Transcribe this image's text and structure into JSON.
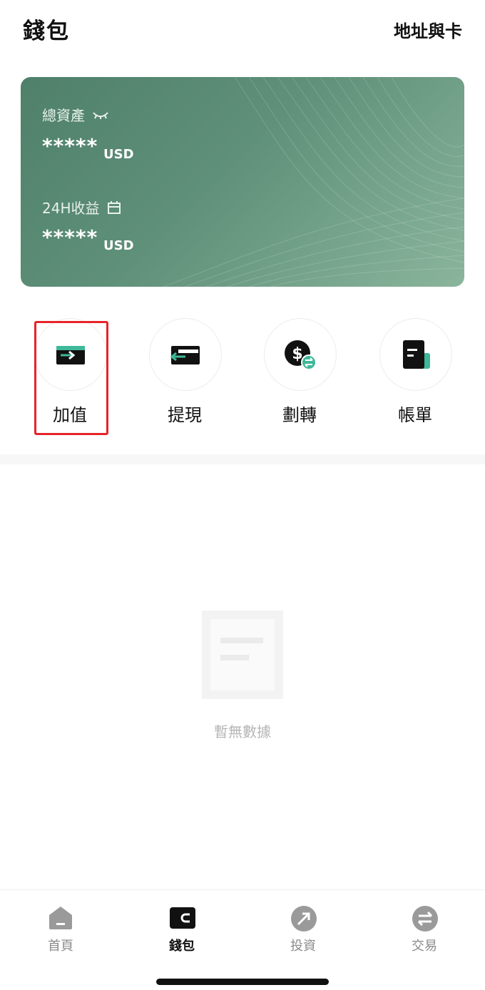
{
  "header": {
    "title": "錢包",
    "address_card_link": "地址與卡"
  },
  "card": {
    "total_assets_label": "總資產",
    "total_assets_value": "*****",
    "total_assets_unit": "USD",
    "pnl_24h_label": "24H收益",
    "pnl_24h_value": "*****",
    "pnl_24h_unit": "USD"
  },
  "actions": [
    {
      "label": "加值",
      "icon": "deposit-icon"
    },
    {
      "label": "提現",
      "icon": "withdraw-icon"
    },
    {
      "label": "劃轉",
      "icon": "transfer-icon"
    },
    {
      "label": "帳單",
      "icon": "bill-icon"
    }
  ],
  "empty_state": {
    "text": "暫無數據",
    "icon": "empty-document-icon"
  },
  "tabbar": [
    {
      "label": "首頁",
      "icon": "home-icon",
      "active": false
    },
    {
      "label": "錢包",
      "icon": "wallet-icon",
      "active": true
    },
    {
      "label": "投資",
      "icon": "invest-icon",
      "active": false
    },
    {
      "label": "交易",
      "icon": "trade-icon",
      "active": false
    }
  ],
  "colors": {
    "accent_green": "#3fb89a",
    "card_green": "#5f9079",
    "highlight_red": "#e8232a"
  }
}
